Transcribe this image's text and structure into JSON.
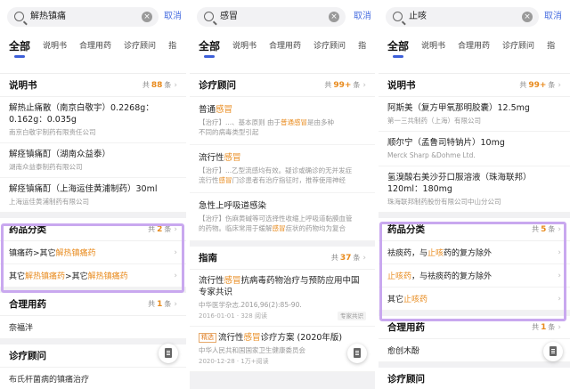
{
  "colors": {
    "accent": "#3d5fd9",
    "link": "#4a6fe0",
    "highlight": "#e88a1c",
    "box": "#c9a8ef"
  },
  "icons": {
    "search": "search-icon",
    "clear": "clear-icon",
    "chevron": "chevron-right-icon",
    "fab": "clipboard-icon"
  },
  "panels": [
    {
      "query": "解热镇痛",
      "cancel": "取消",
      "tabs": [
        "全部",
        "说明书",
        "合理用药",
        "诊疗顾问",
        "指"
      ],
      "s1": {
        "title": "说明书",
        "pre": "共",
        "count": "88",
        "post": "条",
        "items": [
          {
            "title": "解热止痛散（南京白敬宇）0.2268g：0.162g：0.035g",
            "sub": "南京白敬宇制药有限责任公司"
          },
          {
            "title": "解痉镇痛酊（湖南众益泰）",
            "sub": "湖南众益泰制药有限公司"
          },
          {
            "title": "解痉镇痛酊（上海运佳黄浦制药）30ml",
            "sub": "上海运佳黄浦制药有限公司"
          }
        ]
      },
      "s2": {
        "title": "药品分类",
        "pre": "共",
        "count": "2",
        "post": "条",
        "r1": {
          "a": "镇痛药>其它",
          "h": "解热镇痛药"
        },
        "r2": {
          "a": "其它",
          "h1": "解热镇痛药",
          "b": ">其它",
          "h2": "解热镇痛药"
        }
      },
      "s3": {
        "title": "合理用药",
        "pre": "共",
        "count": "1",
        "post": "条",
        "item": "奈福泮"
      },
      "s4": {
        "title": "诊疗顾问",
        "cut": "布氏杆菌病的镇痛治疗"
      }
    },
    {
      "query": "感冒",
      "cancel": "取消",
      "tabs": [
        "全部",
        "说明书",
        "合理用药",
        "诊疗顾问",
        "指"
      ],
      "s1": {
        "title": "诊疗顾问",
        "pre": "共",
        "count": "99+",
        "post": "条",
        "i1": {
          "t1": "普通",
          "th": "感冒",
          "s1a": "【治疗】...、基本原则",
          "s1b": "由于",
          "s1h1": "普通感冒",
          "s1c": "是由多种",
          "s2": "不同的病毒类型引起"
        },
        "i2": {
          "t1": "流行性",
          "th": "感冒",
          "s1a": "【治疗】...乙型流感均有效。疑诊或确诊的无并发症",
          "s2a": "流行性",
          "s2h": "感冒",
          "s2b": "门诊患者有治疗指征时，推荐使用神经"
        },
        "i3": {
          "t1": "急性上呼吸道感染",
          "s1a": "【治疗】伤麻黄碱等可选择性收缩上呼吸道黏膜血管",
          "s2a": "的药物。临床常用于缓解",
          "s2h": "感冒",
          "s2b": "症状的药物均为复合"
        }
      },
      "s2": {
        "title": "指南",
        "pre": "共",
        "count": "37",
        "post": "条",
        "g1": {
          "t1": "流行性",
          "th": "感冒",
          "t2": "抗病毒药物治疗与预防应用中国专家共识",
          "sub": "中华医学杂志.2016,96(2):85-90.",
          "date": "2016-01-01 · 328 阅读",
          "badge": "专家共识"
        },
        "g2": {
          "tag": "精选",
          "t1": "流行性",
          "th": "感冒",
          "t2": "诊疗方案 (2020年版)",
          "sub": "中华人民共和国国家卫生健康委员会",
          "date": "2020-12-28 · 1万+阅读"
        }
      }
    },
    {
      "query": "止咳",
      "cancel": "取消",
      "tabs": [
        "全部",
        "说明书",
        "合理用药",
        "诊疗顾问",
        "指"
      ],
      "s1": {
        "title": "说明书",
        "pre": "共",
        "count": "99+",
        "post": "条",
        "items": [
          {
            "title": "阿斯美（复方甲氧那明胶囊）12.5mg",
            "sub": "第一三共制药（上海）有限公司"
          },
          {
            "title": "顺尔宁（孟鲁司特钠片）10mg",
            "sub": "Merck Sharp &Dohme Ltd."
          },
          {
            "title": "氢溴酸右美沙芬口服溶液（珠海联邦）120ml：180mg",
            "sub": "珠海联邦制药股份有限公司中山分公司"
          }
        ]
      },
      "s2": {
        "title": "药品分类",
        "pre": "共",
        "count": "5",
        "post": "条",
        "r1": {
          "a": "祛痰药，与",
          "h": "止咳",
          "b": "药的复方除外"
        },
        "r2": {
          "h": "止咳药",
          "a": "，与祛痰药的复方除外"
        },
        "r3": {
          "a": "其它",
          "h": "止咳药"
        }
      },
      "s3": {
        "title": "合理用药",
        "pre": "共",
        "count": "1",
        "post": "条",
        "item": "愈创木酚"
      },
      "s4": {
        "title": "诊疗顾问"
      }
    }
  ]
}
